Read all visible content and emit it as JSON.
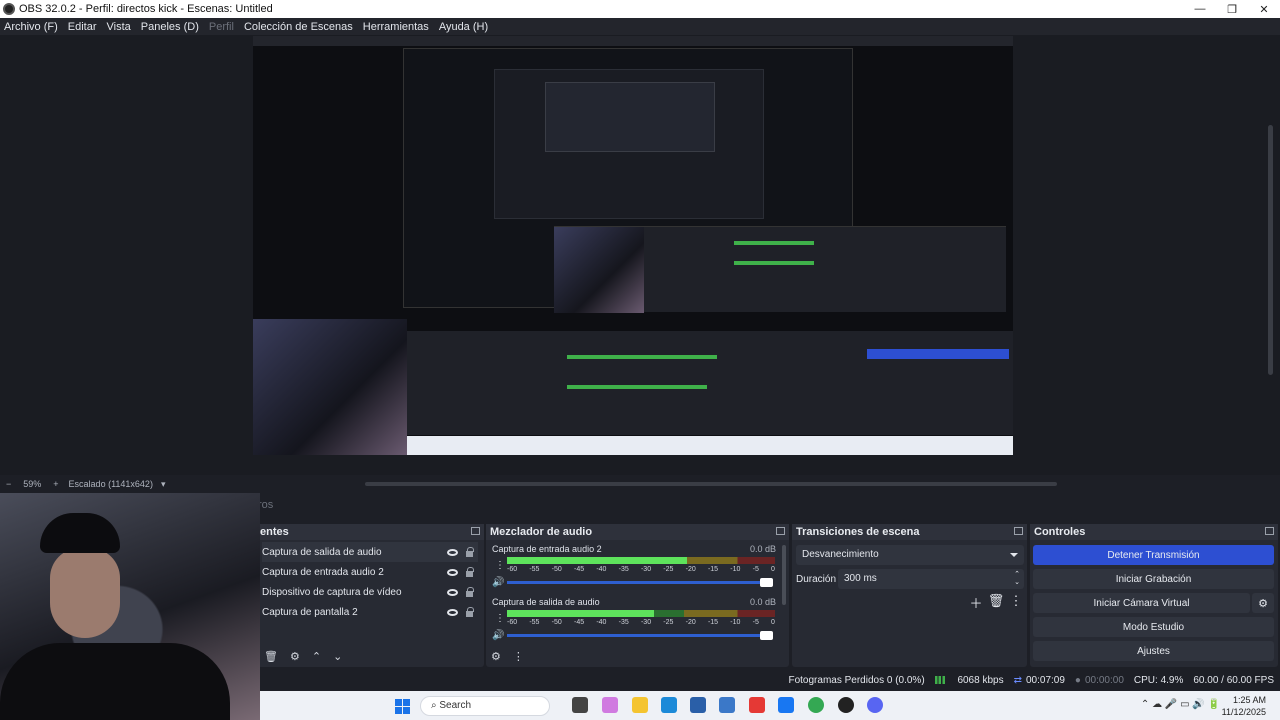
{
  "window": {
    "title": "OBS 32.0.2 - Perfil: directos kick - Escenas: Untitled",
    "controls": [
      "—",
      "❐",
      "✕"
    ]
  },
  "menu": [
    "Archivo (F)",
    "Editar",
    "Vista",
    "Paneles (D)",
    "Perfil",
    "Colección de Escenas",
    "Herramientas",
    "Ayuda (H)"
  ],
  "zoom": {
    "minus": "−",
    "level": "59%",
    "plus": "+",
    "scaled": "Escalado (1141x642)"
  },
  "tab_stub": "ros",
  "sources": {
    "header": "entes",
    "items": [
      "Captura de salida de audio",
      "Captura de entrada audio 2",
      "Dispositivo de captura de vídeo",
      "Captura de pantalla 2"
    ]
  },
  "mixer": {
    "header": "Mezclador de audio",
    "channels": [
      {
        "name": "Captura de entrada audio 2",
        "db": "0.0 dB",
        "level": 0.67
      },
      {
        "name": "Captura de salida de audio",
        "db": "0.0 dB",
        "level": 0.55
      }
    ],
    "ticks": [
      "-60",
      "-55",
      "-50",
      "-45",
      "-40",
      "-35",
      "-30",
      "-25",
      "-20",
      "-15",
      "-10",
      "-5",
      "0"
    ]
  },
  "transitions": {
    "header": "Transiciones de escena",
    "selected": "Desvanecimiento",
    "duration_label": "Duración",
    "duration_value": "300 ms"
  },
  "controls": {
    "header": "Controles",
    "stop_stream": "Detener Transmisión",
    "start_record": "Iniciar Grabación",
    "virtual_cam": "Iniciar Cámara Virtual",
    "studio_mode": "Modo Estudio",
    "settings": "Ajustes"
  },
  "status": {
    "dropped": "Fotogramas Perdidos 0 (0.0%)",
    "bitrate": "6068 kbps",
    "stream_time": "00:07:09",
    "rec_time": "00:00:00",
    "cpu": "CPU: 4.9%",
    "fps": "60.00 / 60.00 FPS"
  },
  "taskbar": {
    "search": "Search",
    "time": "1:25 AM",
    "date": "11/12/2025"
  },
  "colors": {
    "accent": "#2d4fd2",
    "meter_green": "#5ee35c"
  }
}
